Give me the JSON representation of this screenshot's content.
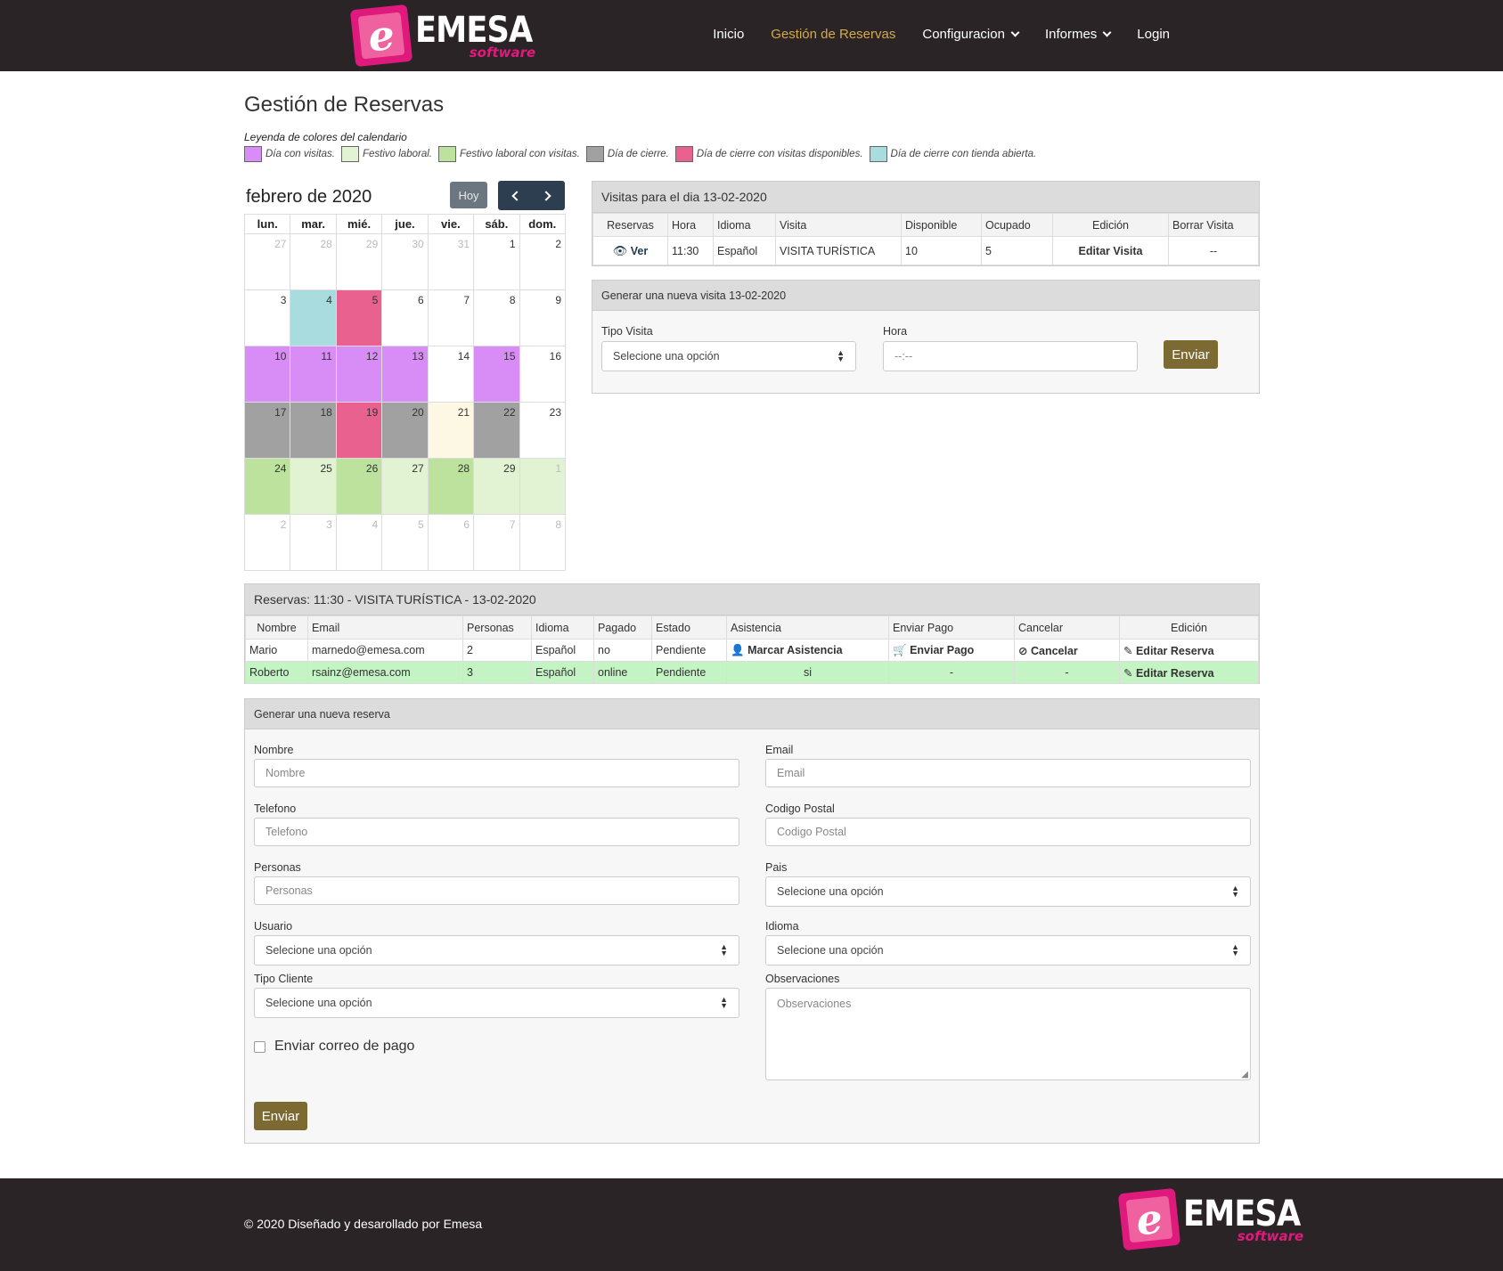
{
  "brand": {
    "name": "EMESA",
    "sub": "software",
    "mark": "e"
  },
  "nav": {
    "items": [
      {
        "label": "Inicio"
      },
      {
        "label": "Gestión de Reservas"
      },
      {
        "label": "Configuracion"
      },
      {
        "label": "Informes"
      },
      {
        "label": "Login"
      }
    ]
  },
  "page": {
    "title": "Gestión de Reservas"
  },
  "legend": {
    "title": "Leyenda de colores del calendario",
    "items": [
      {
        "label": "Día con visitas.",
        "color": "#d88cf5"
      },
      {
        "label": "Festivo laboral.",
        "color": "#e1f3d2"
      },
      {
        "label": "Festivo laboral con visitas.",
        "color": "#bde29e"
      },
      {
        "label": "Día de cierre.",
        "color": "#a1a1a1"
      },
      {
        "label": "Día de cierre con visitas disponibles.",
        "color": "#e9618f"
      },
      {
        "label": "Día de cierre con tienda abierta.",
        "color": "#a8dcdf"
      }
    ]
  },
  "calendar": {
    "title": "febrero de 2020",
    "today_label": "Hoy",
    "weekdays": [
      "lun.",
      "mar.",
      "mié.",
      "jue.",
      "vie.",
      "sáb.",
      "dom."
    ],
    "weeks": [
      [
        "27",
        "28",
        "29",
        "30",
        "31",
        "1",
        "2"
      ],
      [
        "3",
        "4",
        "5",
        "6",
        "7",
        "8",
        "9"
      ],
      [
        "10",
        "11",
        "12",
        "13",
        "14",
        "15",
        "16"
      ],
      [
        "17",
        "18",
        "19",
        "20",
        "21",
        "22",
        "23"
      ],
      [
        "24",
        "25",
        "26",
        "27",
        "28",
        "29",
        "1"
      ],
      [
        "2",
        "3",
        "4",
        "5",
        "6",
        "7",
        "8"
      ]
    ]
  },
  "visits": {
    "title": "Visitas para el dia 13-02-2020",
    "headers": [
      "Reservas",
      "Hora",
      "Idioma",
      "Visita",
      "Disponible",
      "Ocupado",
      "Edición",
      "Borrar Visita"
    ],
    "row": {
      "ver": "Ver",
      "hora": "11:30",
      "idioma": "Español",
      "visita": "VISITA TURÍSTICA",
      "disponible": "10",
      "ocupado": "5",
      "edicion": "Editar Visita",
      "borrar": "--"
    }
  },
  "new_visit": {
    "title": "Generar una nueva visita 13-02-2020",
    "tipo_label": "Tipo Visita",
    "tipo_value": "Selecione una opción",
    "hora_label": "Hora",
    "hora_value": "--:--",
    "submit": "Enviar"
  },
  "reservations": {
    "title": "Reservas: 11:30 - VISITA TURÍSTICA - 13-02-2020",
    "headers": [
      "Nombre",
      "Email",
      "Personas",
      "Idioma",
      "Pagado",
      "Estado",
      "Asistencia",
      "Enviar Pago",
      "Cancelar",
      "Edición"
    ],
    "rows": [
      {
        "nombre": "Mario",
        "email": "marnedo@emesa.com",
        "personas": "2",
        "idioma": "Español",
        "pagado": "no",
        "estado": "Pendiente",
        "asistencia": "Marcar Asistencia",
        "pago": "Enviar Pago",
        "cancelar": "Cancelar",
        "edicion": "Editar Reserva"
      },
      {
        "nombre": "Roberto",
        "email": "rsainz@emesa.com",
        "personas": "3",
        "idioma": "Español",
        "pagado": "online",
        "estado": "Pendiente",
        "asistencia": "si",
        "pago": "-",
        "cancelar": "-",
        "edicion": "Editar Reserva"
      }
    ]
  },
  "new_reservation": {
    "title": "Generar una nueva reserva",
    "nombre_label": "Nombre",
    "nombre_ph": "Nombre",
    "email_label": "Email",
    "email_ph": "Email",
    "telefono_label": "Telefono",
    "telefono_ph": "Telefono",
    "cp_label": "Codigo Postal",
    "cp_ph": "Codigo Postal",
    "personas_label": "Personas",
    "personas_ph": "Personas",
    "pais_label": "Pais",
    "pais_value": "Selecione una opción",
    "usuario_label": "Usuario",
    "usuario_value": "Selecione una opción",
    "idioma_label": "Idioma",
    "idioma_value": "Selecione una opción",
    "tipo_label": "Tipo Cliente",
    "tipo_value": "Selecione una opción",
    "obs_label": "Observaciones",
    "obs_ph": "Observaciones",
    "checkbox_label": "Enviar correo de pago",
    "submit": "Enviar"
  },
  "footer": {
    "text": "© 2020  Diseñado y desarollado por Emesa"
  }
}
